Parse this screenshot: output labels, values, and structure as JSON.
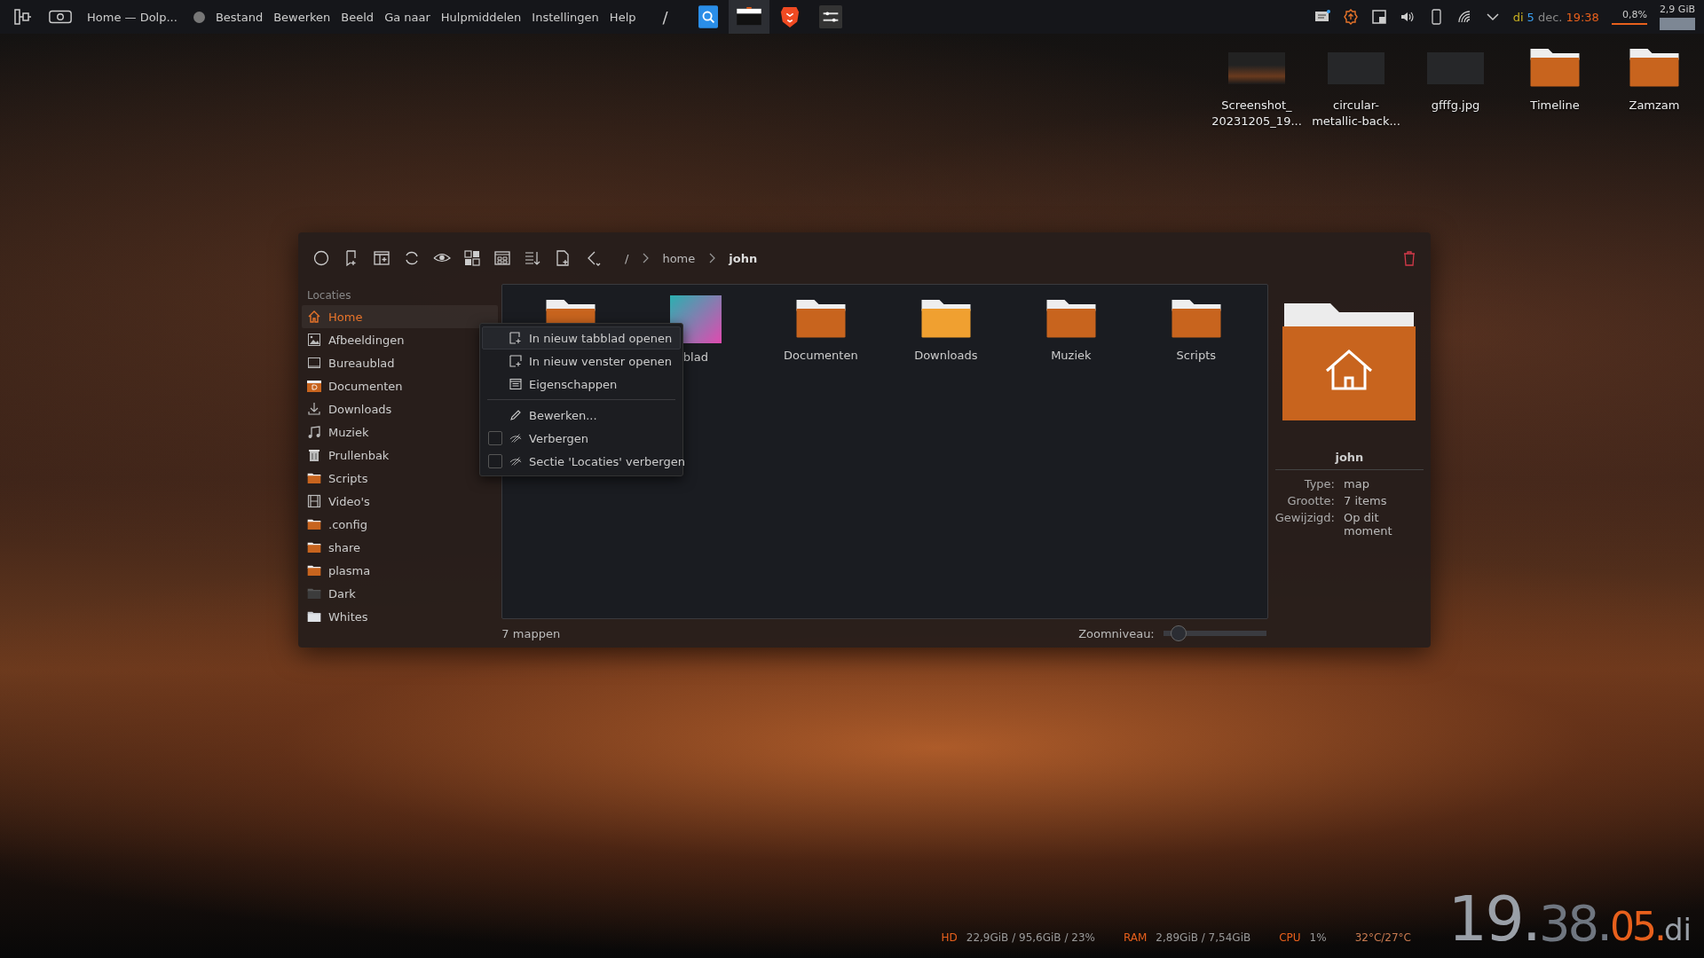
{
  "panel": {
    "window_title": "Home — Dolp...",
    "menu": [
      "Bestand",
      "Bewerken",
      "Beeld",
      "Ga naar",
      "Hulpmiddelen",
      "Instellingen",
      "Help"
    ],
    "separator": "/",
    "clock": {
      "day": "di",
      "date": "5",
      "month": "dec.",
      "time": "19:38"
    },
    "cpu": "0,8%",
    "memory": "2,9 GiB"
  },
  "desktop_icons": [
    {
      "lines": [
        "Screenshot_",
        "20231205_19..."
      ],
      "kind": "screenshot"
    },
    {
      "lines": [
        "circular-",
        "metallic-back..."
      ],
      "kind": "dark-image"
    },
    {
      "lines": [
        "gfffg.jpg"
      ],
      "kind": "dark-image"
    },
    {
      "lines": [
        "Timeline"
      ],
      "kind": "folder"
    },
    {
      "lines": [
        "Zamzam"
      ],
      "kind": "folder"
    }
  ],
  "window": {
    "breadcrumb": [
      {
        "label": "/",
        "current": false
      },
      {
        "label": "home",
        "current": false
      },
      {
        "label": "john",
        "current": true
      }
    ],
    "sidebar": {
      "heading": "Locaties",
      "items": [
        {
          "label": "Home",
          "kind": "home",
          "selected": true
        },
        {
          "label": "Afbeeldingen",
          "kind": "pictures",
          "selected": false
        },
        {
          "label": "Bureaublad",
          "kind": "desktop",
          "selected": false
        },
        {
          "label": "Documenten",
          "kind": "documents",
          "selected": false
        },
        {
          "label": "Downloads",
          "kind": "download",
          "selected": false
        },
        {
          "label": "Muziek",
          "kind": "music",
          "selected": false
        },
        {
          "label": "Prullenbak",
          "kind": "trash",
          "selected": false
        },
        {
          "label": "Scripts",
          "kind": "folder",
          "selected": false
        },
        {
          "label": "Video's",
          "kind": "video",
          "selected": false
        },
        {
          "label": ".config",
          "kind": "folder",
          "selected": false
        },
        {
          "label": "share",
          "kind": "folder",
          "selected": false
        },
        {
          "label": "plasma",
          "kind": "folder",
          "selected": false
        },
        {
          "label": "Dark",
          "kind": "folder-grey",
          "selected": false
        },
        {
          "label": "Whites",
          "kind": "folder-light",
          "selected": false
        }
      ]
    },
    "files": [
      {
        "kind": "folder"
      },
      {
        "label": "blad",
        "kind": "wallpaper"
      },
      {
        "label": "Documenten",
        "kind": "folder"
      },
      {
        "label": "Downloads",
        "kind": "folder-bright"
      },
      {
        "label": "Muziek",
        "kind": "folder"
      },
      {
        "label": "Scripts",
        "kind": "folder"
      }
    ],
    "context_menu": [
      {
        "label": "In nieuw tabblad openen",
        "kind": "action",
        "highlighted": true
      },
      {
        "label": "In nieuw venster openen",
        "kind": "action",
        "highlighted": false
      },
      {
        "label": "Eigenschappen",
        "kind": "action",
        "highlighted": false
      },
      {
        "kind": "separator"
      },
      {
        "label": "Bewerken...",
        "kind": "action",
        "highlighted": false
      },
      {
        "label": "Verbergen",
        "kind": "checkbox",
        "checked": false,
        "highlighted": false
      },
      {
        "label": "Sectie 'Locaties' verbergen",
        "kind": "checkbox",
        "checked": false,
        "highlighted": false
      }
    ],
    "status": "7 mappen",
    "zoom": {
      "label": "Zoomniveau:",
      "level": 0.15
    },
    "info": {
      "name": "john",
      "fields": [
        {
          "key": "Type:",
          "value": "map"
        },
        {
          "key": "Grootte:",
          "value": "7 items"
        },
        {
          "key": "Gewijzigd:",
          "value": "Op dit moment"
        }
      ]
    }
  },
  "system_monitor": [
    {
      "label": "HD",
      "value": "22,9GiB / 95,6GiB / 23%"
    },
    {
      "label": "RAM",
      "value": "2,89GiB / 7,54GiB"
    },
    {
      "label": "CPU",
      "value": "1%"
    },
    {
      "value": "32°C/27°C"
    }
  ],
  "big_clock": {
    "hours": "19.",
    "minutes": "38.",
    "seconds": "05.",
    "day": "di"
  }
}
